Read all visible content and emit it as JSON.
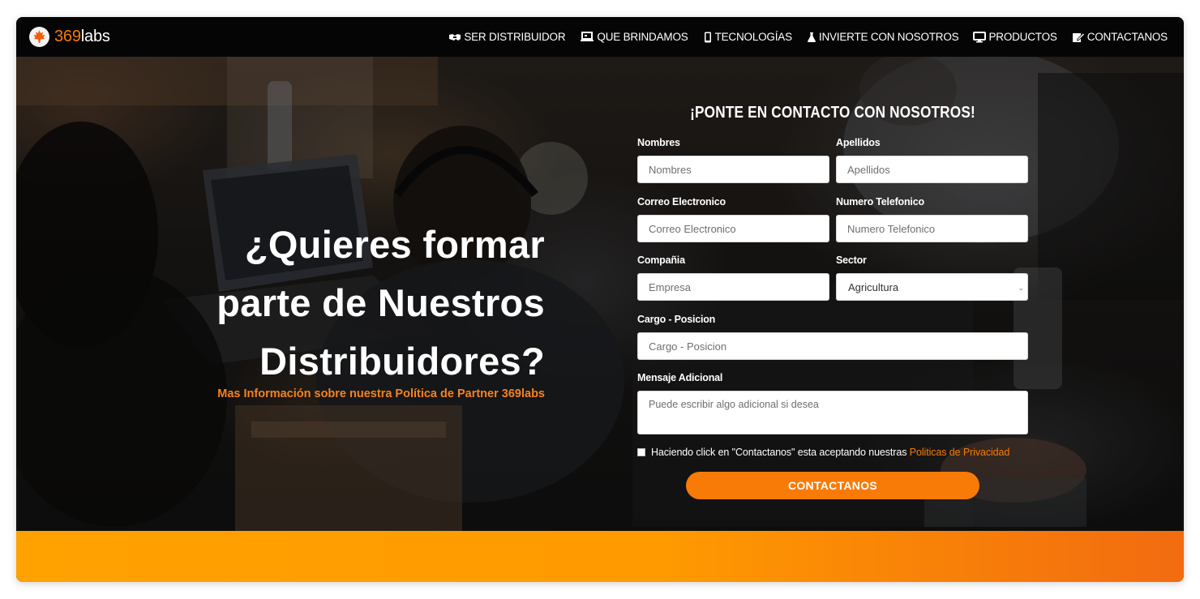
{
  "brand": {
    "prefix": "369",
    "suffix": "labs",
    "logo_icon": "maple-leaf-icon"
  },
  "nav": {
    "items": [
      {
        "label": "SER DISTRIBUIDOR",
        "icon": "handshake-icon"
      },
      {
        "label": "QUE BRINDAMOS",
        "icon": "laptop-icon"
      },
      {
        "label": "TECNOLOGÍAS",
        "icon": "mobile-icon"
      },
      {
        "label": "INVIERTE CON NOSOTROS",
        "icon": "flask-icon"
      },
      {
        "label": "PRODUCTOS",
        "icon": "desktop-icon"
      },
      {
        "label": "CONTACTANOS",
        "icon": "edit-icon"
      }
    ]
  },
  "hero": {
    "headline_line1": "¿Quieres formar",
    "headline_line2": "parte de Nuestros",
    "headline_line3": "Distribuidores?",
    "subline": "Mas Información sobre nuestra Política de Partner 369labs"
  },
  "form": {
    "title": "¡PONTE EN CONTACTO CON NOSOTROS!",
    "fields": {
      "nombres": {
        "label": "Nombres",
        "placeholder": "Nombres"
      },
      "apellidos": {
        "label": "Apellidos",
        "placeholder": "Apellidos"
      },
      "correo": {
        "label": "Correo Electronico",
        "placeholder": "Correo Electronico"
      },
      "telefono": {
        "label": "Numero Telefonico",
        "placeholder": "Numero Telefonico"
      },
      "compania": {
        "label": "Compañia",
        "placeholder": "Empresa"
      },
      "sector": {
        "label": "Sector",
        "value": "Agricultura"
      },
      "cargo": {
        "label": "Cargo - Posicion",
        "placeholder": "Cargo - Posicion"
      },
      "mensaje": {
        "label": "Mensaje Adicional",
        "placeholder": "Puede escribir algo adicional si desea"
      }
    },
    "consent_text": "Haciendo click en \"Contactanos\" esta aceptando nuestras ",
    "consent_link": "Politicas de Privacidad",
    "submit_label": "CONTACTANOS"
  },
  "colors": {
    "accent": "#f77b06",
    "band_start": "#ffa200",
    "band_end": "#f26b10",
    "nav_bg": "#050505"
  }
}
